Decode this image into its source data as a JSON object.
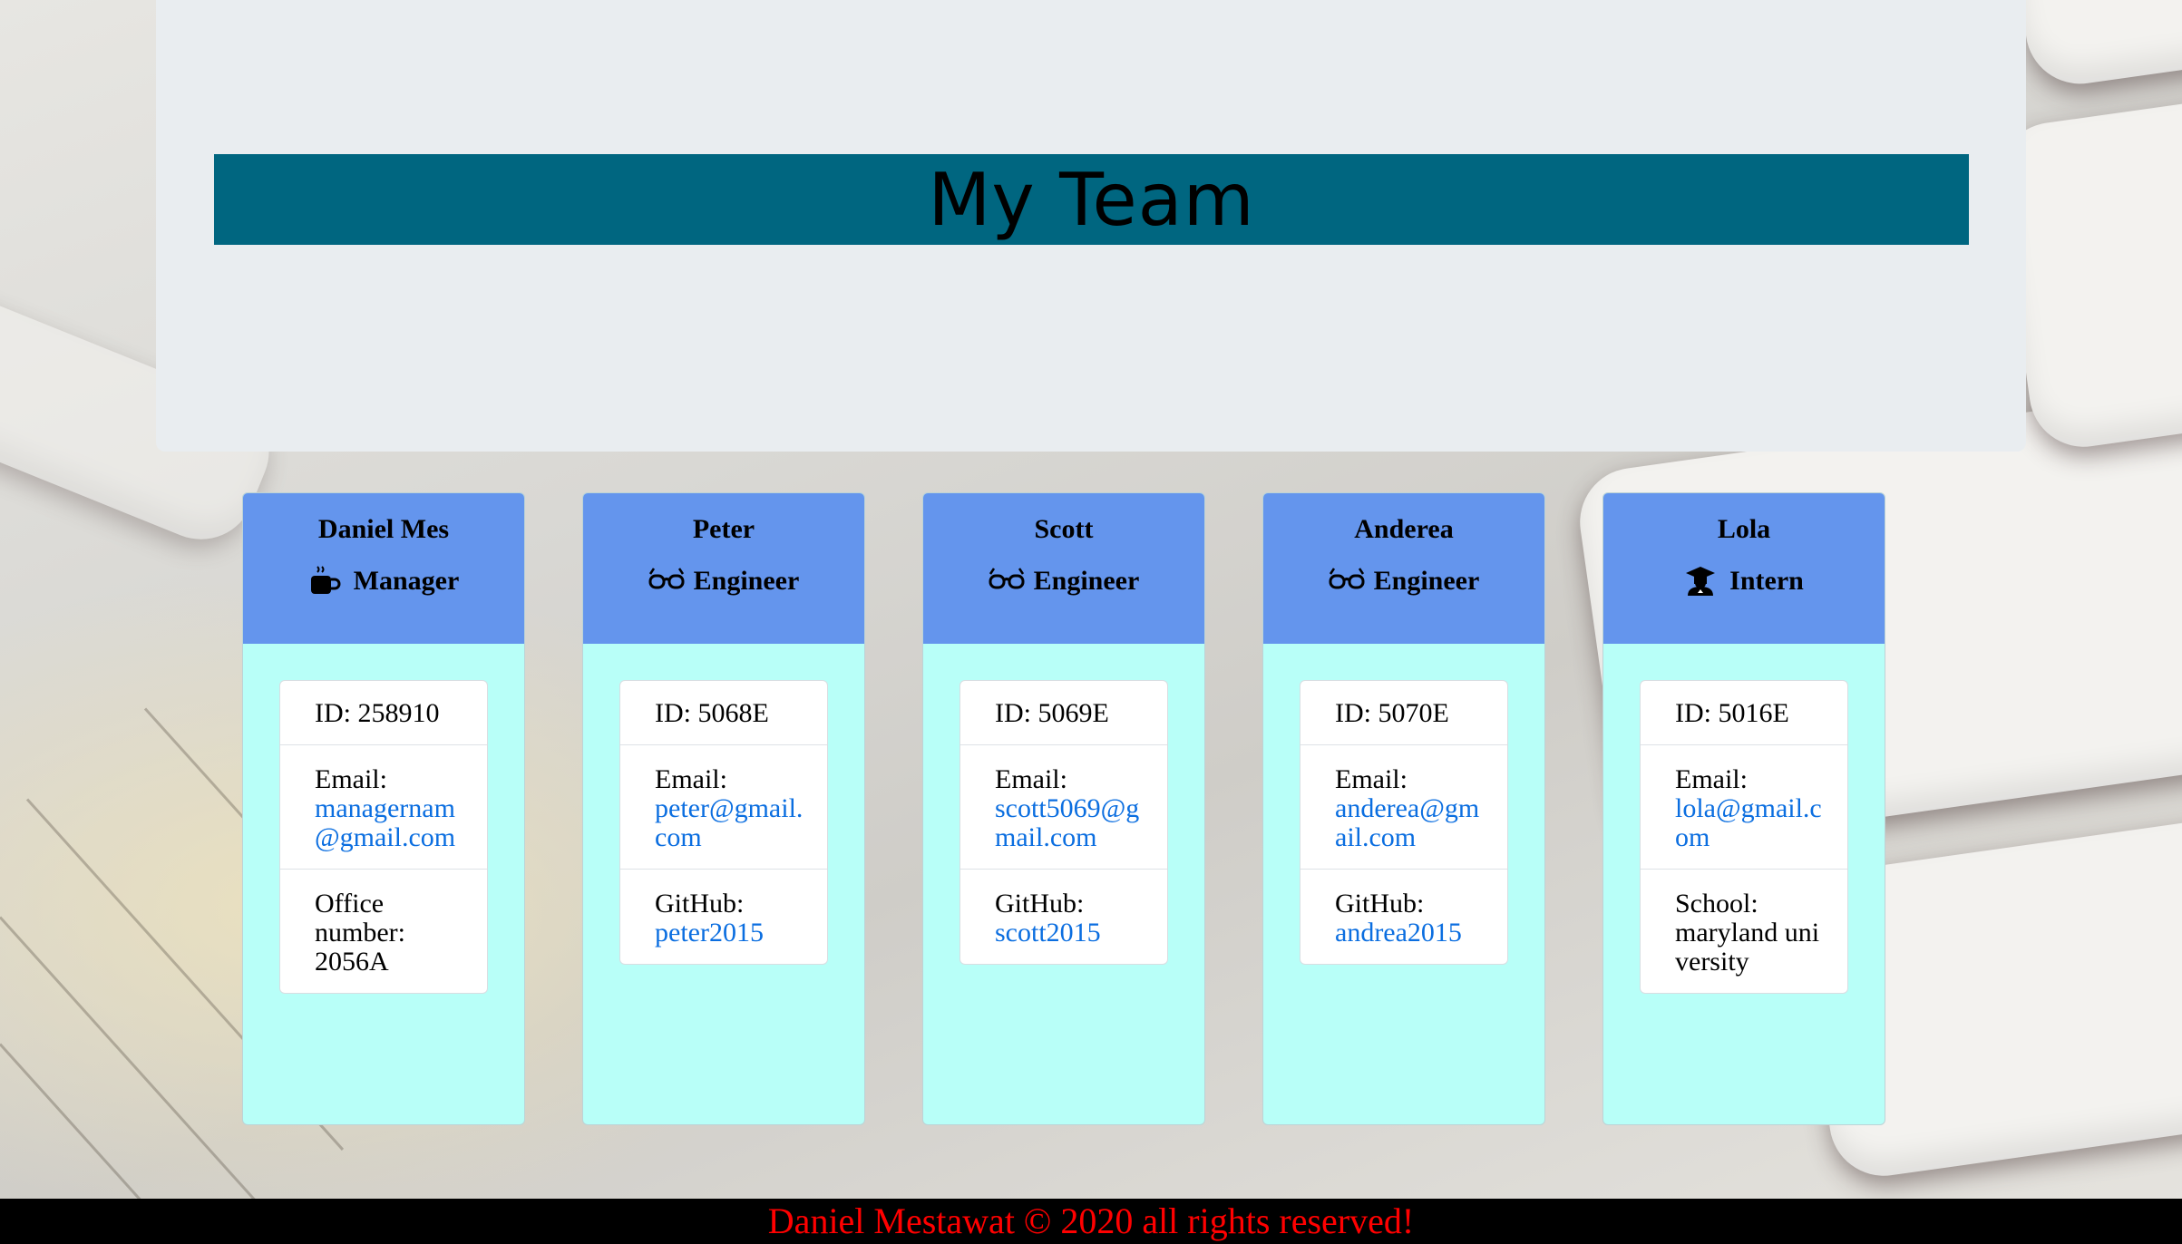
{
  "header": {
    "title": "My Team"
  },
  "team": [
    {
      "name": "Daniel Mes",
      "role": "Manager",
      "icon": "coffee-icon",
      "id_label": "ID: 258910",
      "email_label": "Email:",
      "email": "managernam@gmail.com",
      "extra_label": "Office number:",
      "extra_value": "2056A",
      "extra_is_link": false
    },
    {
      "name": "Peter",
      "role": "Engineer",
      "icon": "glasses-icon",
      "id_label": "ID: 5068E",
      "email_label": "Email:",
      "email": "peter@gmail.com",
      "extra_label": "GitHub:",
      "extra_value": "peter2015",
      "extra_is_link": true
    },
    {
      "name": "Scott",
      "role": "Engineer",
      "icon": "glasses-icon",
      "id_label": "ID: 5069E",
      "email_label": "Email:",
      "email": "scott5069@gmail.com",
      "extra_label": "GitHub:",
      "extra_value": "scott2015",
      "extra_is_link": true
    },
    {
      "name": "Anderea",
      "role": "Engineer",
      "icon": "glasses-icon",
      "id_label": "ID: 5070E",
      "email_label": "Email:",
      "email": "anderea@gmail.com",
      "extra_label": "GitHub:",
      "extra_value": "andrea2015",
      "extra_is_link": true
    },
    {
      "name": "Lola",
      "role": "Intern",
      "icon": "graduate-icon",
      "id_label": "ID: 5016E",
      "email_label": "Email:",
      "email": "lola@gmail.com",
      "extra_label": "School:",
      "extra_value": "maryland university",
      "extra_is_link": false
    }
  ],
  "footer": {
    "text": "Daniel Mestawat © 2020 all rights reserved!"
  },
  "colors": {
    "title_bar": "#006680",
    "card_header": "#6495ed",
    "card_body": "#b8fff8",
    "link": "#0b6ee0",
    "footer_text": "#ff0000"
  }
}
